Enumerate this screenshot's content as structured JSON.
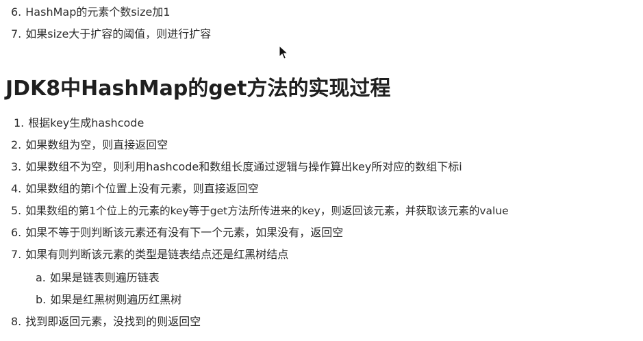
{
  "top_list": [
    {
      "num": "6.",
      "text": "HashMap的元素个数size加1"
    },
    {
      "num": "7.",
      "text": "如果size大于扩容的阈值，则进行扩容"
    }
  ],
  "section": {
    "title": "JDK8中HashMap的get方法的实现过程"
  },
  "steps": [
    {
      "num": "1.",
      "text": "根据key生成hashcode"
    },
    {
      "num": "2.",
      "text": "如果数组为空，则直接返回空"
    },
    {
      "num": "3.",
      "text": "如果数组不为空，则利用hashcode和数组长度通过逻辑与操作算出key所对应的数组下标i"
    },
    {
      "num": "4.",
      "text": "如果数组的第i个位置上没有元素，则直接返回空"
    },
    {
      "num": "5.",
      "text": "如果数组的第1个位上的元素的key等于get方法所传进来的key，则返回该元素，并获取该元素的value"
    },
    {
      "num": "6.",
      "text": "如果不等于则判断该元素还有没有下一个元素，如果没有，返回空"
    },
    {
      "num": "7.",
      "text": "如果有则判断该元素的类型是链表结点还是红黑树结点"
    },
    {
      "num": "a.",
      "text": "如果是链表则遍历链表"
    },
    {
      "num": "b.",
      "text": "如果是红黑树则遍历红黑树"
    },
    {
      "num": "8.",
      "text": "找到即返回元素，没找到的则返回空"
    }
  ],
  "cursor": {
    "icon": "mouse-pointer-icon",
    "color": "#111111"
  }
}
